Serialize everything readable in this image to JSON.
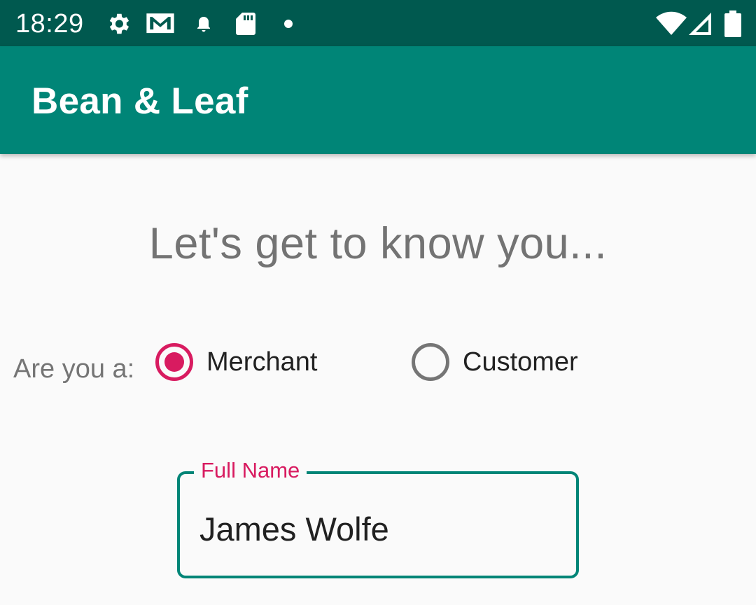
{
  "status_bar": {
    "time": "18:29",
    "left_icons": [
      "gear-icon",
      "gmail-icon",
      "notification-bell-icon",
      "sd-card-icon",
      "dot-icon"
    ],
    "right_icons": [
      "wifi-icon",
      "cell-signal-icon",
      "battery-icon"
    ]
  },
  "app_bar": {
    "title": "Bean & Leaf",
    "color": "#008577"
  },
  "main": {
    "headline": "Let's get to know you...",
    "role_question": "Are you a:",
    "role_options": [
      {
        "label": "Merchant",
        "selected": true
      },
      {
        "label": "Customer",
        "selected": false
      }
    ],
    "full_name_field": {
      "label": "Full Name",
      "value": "James Wolfe"
    }
  },
  "colors": {
    "status_bar": "#00594f",
    "primary": "#008577",
    "accent": "#d81b60",
    "background": "#fafafa"
  }
}
